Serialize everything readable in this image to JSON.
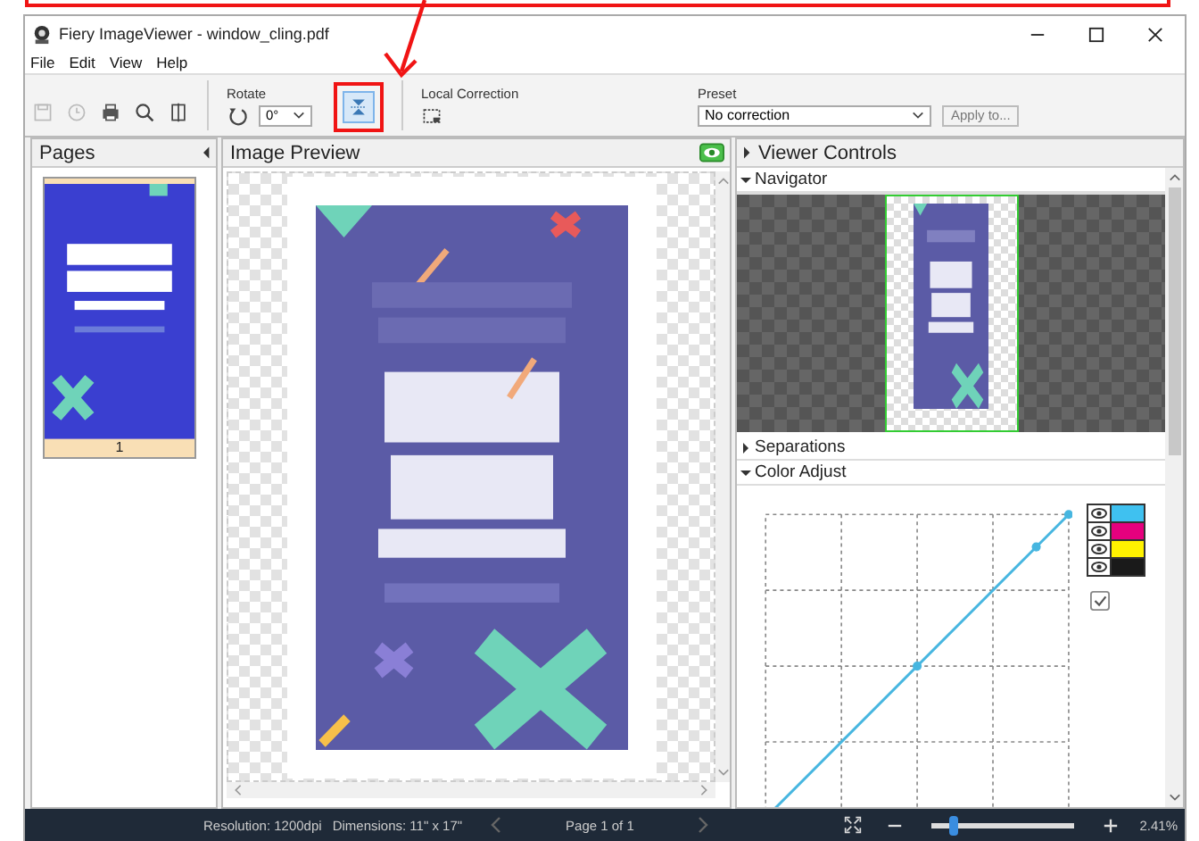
{
  "window": {
    "title": "Fiery ImageViewer - window_cling.pdf"
  },
  "menu": [
    "File",
    "Edit",
    "View",
    "Help"
  ],
  "toolbar": {
    "rotate_label": "Rotate",
    "rotate_value": "0°",
    "local_correction_label": "Local Correction",
    "preset_label": "Preset",
    "preset_value": "No correction",
    "apply_button": "Apply to..."
  },
  "pages": {
    "title": "Pages",
    "items": [
      {
        "label": "1",
        "selected": true
      }
    ]
  },
  "preview": {
    "title": "Image Preview"
  },
  "viewer_controls": {
    "title": "Viewer Controls",
    "sections": [
      {
        "kind": "navigator",
        "title": "Navigator",
        "expanded": true
      },
      {
        "kind": "separations",
        "title": "Separations",
        "expanded": false
      },
      {
        "kind": "color_adjust",
        "title": "Color Adjust",
        "expanded": true
      }
    ]
  },
  "color_adjust": {
    "channels": [
      {
        "color": "#3fc1f0",
        "visible": true
      },
      {
        "color": "#e6007e",
        "visible": true
      },
      {
        "color": "#fff200",
        "visible": true
      },
      {
        "color": "#1a1a1a",
        "visible": true
      }
    ],
    "linked": {
      "checked": true
    }
  },
  "status_bar": {
    "resolution": "Resolution: 1200dpi",
    "dimensions": "Dimensions: 11\" x 17\"",
    "page": "Page 1 of 1",
    "zoom": {
      "level": 0.15
    },
    "zoom_text": "2.41%"
  }
}
